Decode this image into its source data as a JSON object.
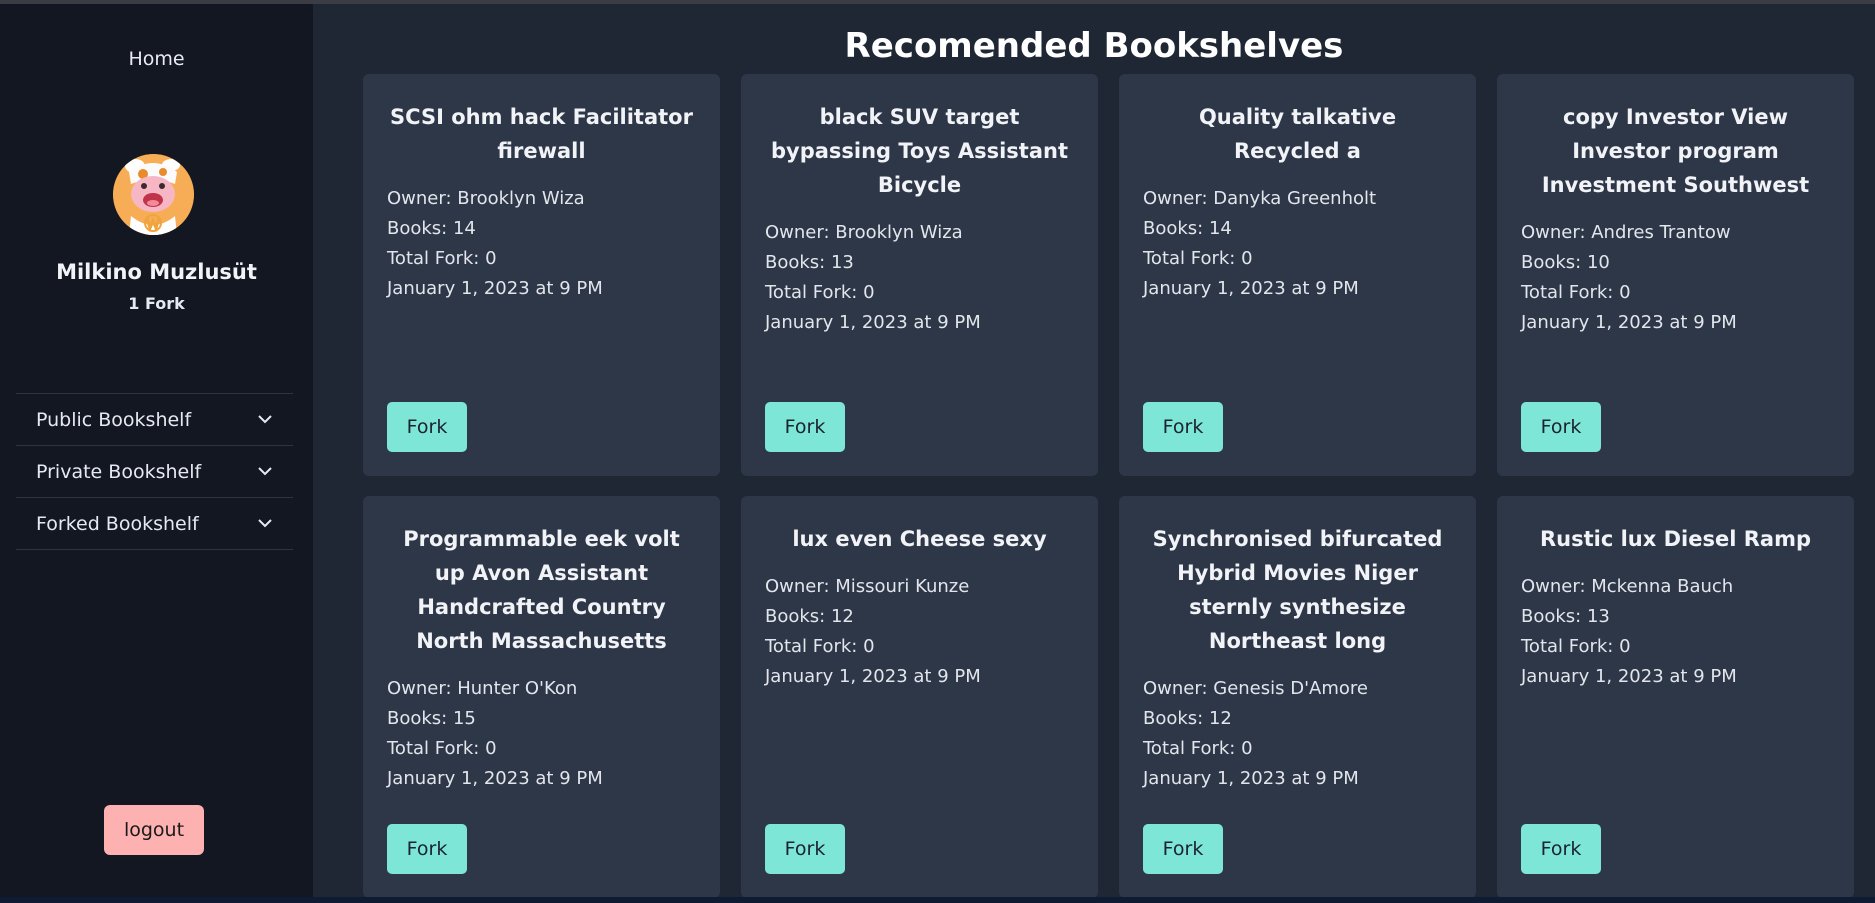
{
  "sidebar": {
    "home_label": "Home",
    "user": {
      "name": "Milkino Muzlusüt",
      "forks": "1 Fork"
    },
    "menu": [
      {
        "label": "Public Bookshelf",
        "icon": "chevron-down-icon"
      },
      {
        "label": "Private Bookshelf",
        "icon": "chevron-down-icon"
      },
      {
        "label": "Forked Bookshelf",
        "icon": "chevron-down-icon"
      }
    ],
    "logout_label": "logout"
  },
  "main": {
    "title": "Recomended Bookshelves",
    "fork_label": "Fork",
    "cards": [
      {
        "title": "SCSI ohm hack Facilitator firewall",
        "owner": "Owner: Brooklyn Wiza",
        "books": "Books: 14",
        "total_fork": "Total Fork: 0",
        "date": "January 1, 2023 at 9 PM"
      },
      {
        "title": "black SUV target bypassing Toys Assistant Bicycle",
        "owner": "Owner: Brooklyn Wiza",
        "books": "Books: 13",
        "total_fork": "Total Fork: 0",
        "date": "January 1, 2023 at 9 PM"
      },
      {
        "title": "Quality talkative Recycled a",
        "owner": "Owner: Danyka Greenholt",
        "books": "Books: 14",
        "total_fork": "Total Fork: 0",
        "date": "January 1, 2023 at 9 PM"
      },
      {
        "title": "copy Investor View Investor program Investment Southwest",
        "owner": "Owner: Andres Trantow",
        "books": "Books: 10",
        "total_fork": "Total Fork: 0",
        "date": "January 1, 2023 at 9 PM"
      },
      {
        "title": "Programmable eek volt up Avon Assistant Handcrafted Country North Massachusetts",
        "owner": "Owner: Hunter O'Kon",
        "books": "Books: 15",
        "total_fork": "Total Fork: 0",
        "date": "January 1, 2023 at 9 PM"
      },
      {
        "title": "lux even Cheese sexy",
        "owner": "Owner: Missouri Kunze",
        "books": "Books: 12",
        "total_fork": "Total Fork: 0",
        "date": "January 1, 2023 at 9 PM"
      },
      {
        "title": "Synchronised bifurcated Hybrid Movies Niger sternly synthesize Northeast long",
        "owner": "Owner: Genesis D'Amore",
        "books": "Books: 12",
        "total_fork": "Total Fork: 0",
        "date": "January 1, 2023 at 9 PM"
      },
      {
        "title": "Rustic lux Diesel Ramp",
        "owner": "Owner: Mckenna Bauch",
        "books": "Books: 13",
        "total_fork": "Total Fork: 0",
        "date": "January 1, 2023 at 9 PM"
      }
    ]
  }
}
